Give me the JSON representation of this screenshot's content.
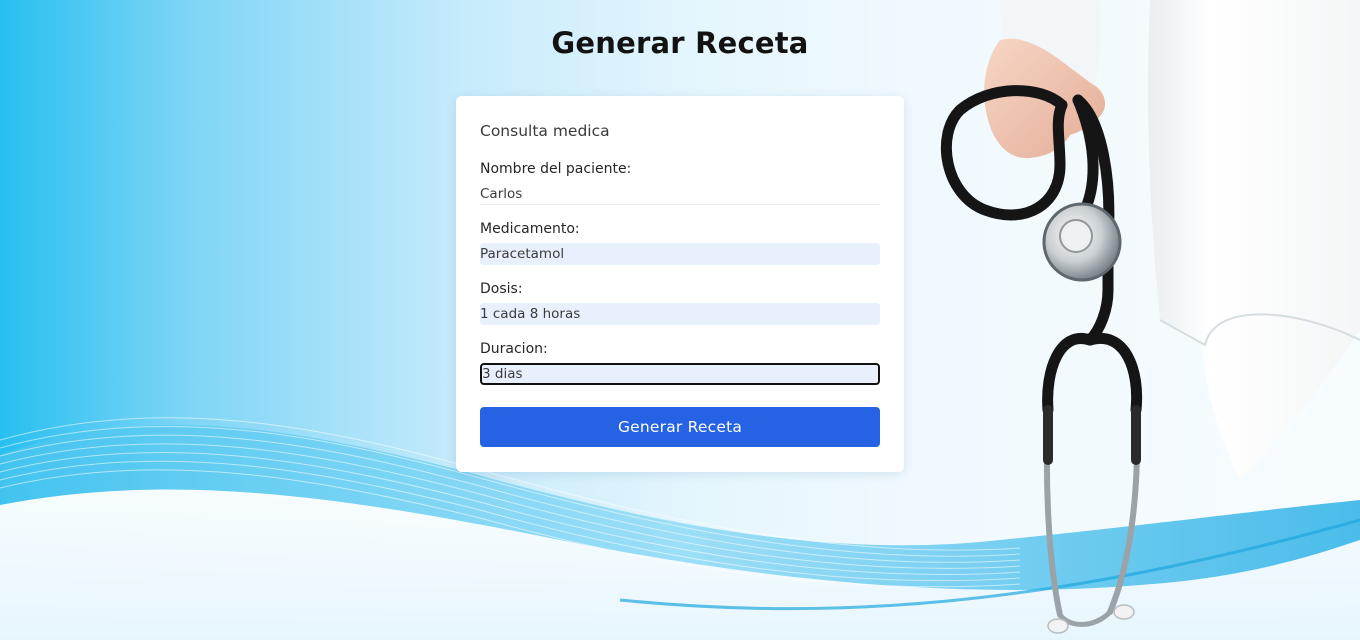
{
  "page": {
    "title": "Generar Receta"
  },
  "form": {
    "title": "Consulta medica",
    "patient_label": "Nombre del paciente:",
    "patient_value": "Carlos",
    "medication_label": "Medicamento:",
    "medication_value": "Paracetamol",
    "dose_label": "Dosis:",
    "dose_value": "1 cada 8 horas",
    "duration_label": "Duracion:",
    "duration_value": "3 dias",
    "submit_label": "Generar Receta"
  },
  "theme": {
    "accent": "#2563e4",
    "background_left": "#27bff0",
    "background_right": "#f7fcff",
    "autofill_bg": "#e8f0fe"
  }
}
